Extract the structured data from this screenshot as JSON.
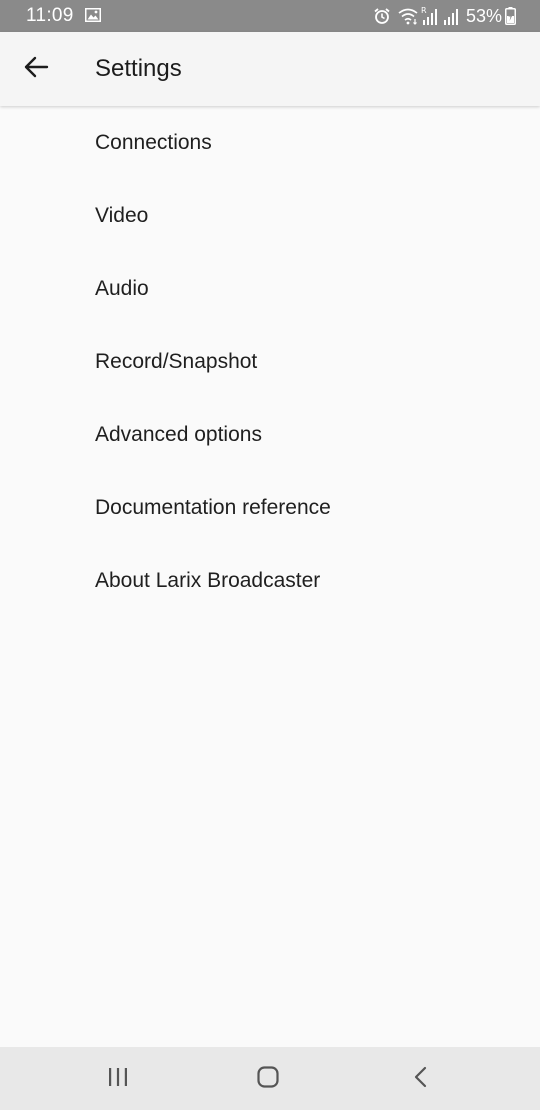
{
  "status_bar": {
    "time": "11:09",
    "battery": "53%",
    "icons": [
      "gallery-icon",
      "alarm-icon",
      "wifi-icon",
      "signal-roaming-icon",
      "signal-icon",
      "battery-charging-icon"
    ]
  },
  "app_bar": {
    "title": "Settings",
    "back_icon": "arrow-left-icon"
  },
  "menu": {
    "items": [
      {
        "label": "Connections"
      },
      {
        "label": "Video"
      },
      {
        "label": "Audio"
      },
      {
        "label": "Record/Snapshot"
      },
      {
        "label": "Advanced options"
      },
      {
        "label": "Documentation reference"
      },
      {
        "label": "About Larix Broadcaster"
      }
    ]
  },
  "nav_bar": {
    "icons": [
      "recent-apps-icon",
      "home-icon",
      "back-icon"
    ]
  },
  "colors": {
    "status_bar_bg": "#8a8a8a",
    "app_bar_bg": "#f5f5f5",
    "page_bg": "#fafafa",
    "nav_bar_bg": "#e8e8e8",
    "text": "#1f1f1f"
  }
}
